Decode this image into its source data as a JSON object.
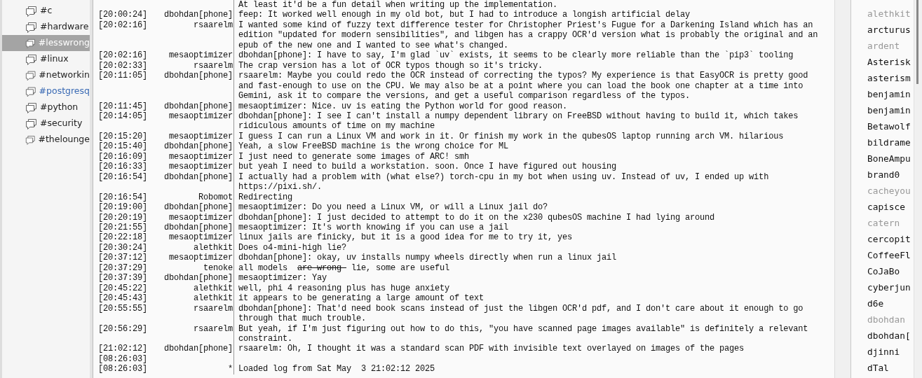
{
  "channels": [
    {
      "name": "#c",
      "selected": false,
      "activity": false
    },
    {
      "name": "#hardware",
      "selected": false,
      "activity": false
    },
    {
      "name": "#lesswrong",
      "selected": true,
      "activity": false
    },
    {
      "name": "#linux",
      "selected": false,
      "activity": false
    },
    {
      "name": "#networkin",
      "selected": false,
      "activity": false
    },
    {
      "name": "#postgresq",
      "selected": false,
      "activity": true
    },
    {
      "name": "#python",
      "selected": false,
      "activity": false
    },
    {
      "name": "#security",
      "selected": false,
      "activity": false
    },
    {
      "name": "#thelounge",
      "selected": false,
      "activity": false
    }
  ],
  "messages": [
    {
      "text": "At least it'd be a fun detail when writing up the implementation."
    },
    {
      "time": "[20:00:24]",
      "nick": "dbohdan[phone]",
      "text": "feep: It worked well enough in my old bot, but I had to introduce a longish artificial delay"
    },
    {
      "time": "[20:02:16]",
      "nick": "rsaarelm",
      "text": "I wanted some kind of fuzzy text difference tester for Christopher Priest's Fugue for a Darkening Island which has an edition \"updated for modern sensibilities\", and libgen has a crappy OCR'd version what is probably the original and an epub of the new one and I wanted to see what's changed."
    },
    {
      "time": "[20:02:16]",
      "nick": "mesaoptimizer",
      "text": "dbohdan[phone]: I have to say, I'm glad `uv` exists, it seems to be clearly more reliable than the `pip3` tooling"
    },
    {
      "time": "[20:02:33]",
      "nick": "rsaarelm",
      "text": "The crap version has a lot of OCR typos though so it's tricky."
    },
    {
      "time": "[20:11:05]",
      "nick": "dbohdan[phone]",
      "text": "rsaarelm: Maybe you could redo the OCR instead of correcting the typos? My experience is that EasyOCR is pretty good and fast-enough to use on the CPU. We may also be at a point where you can load the book one chapter at a time into Gemini, ask it to compare the versions, and get a useful comparison regardless of the typos."
    },
    {
      "time": "[20:11:45]",
      "nick": "dbohdan[phone]",
      "text": "mesaoptimizer: Nice. uv is eating the Python world for good reason."
    },
    {
      "time": "[20:14:05]",
      "nick": "mesaoptimizer",
      "text": "dbohdan[phone]: I see I can't install a numpy dependent library on FreeBSD without having to build it, which takes ridiculous amounts of time on my machine"
    },
    {
      "time": "[20:15:20]",
      "nick": "mesaoptimizer",
      "text": "I guess I can run a Linux VM and work in it. Or finish my work in the qubesOS laptop running arch VM. hilarious"
    },
    {
      "time": "[20:15:40]",
      "nick": "dbohdan[phone]",
      "text": "Yeah, a slow FreeBSD machine is the wrong choice for ML"
    },
    {
      "time": "[20:16:09]",
      "nick": "mesaoptimizer",
      "text": "I just need to generate some images of ARC! smh"
    },
    {
      "time": "[20:16:33]",
      "nick": "mesaoptimizer",
      "text": "but yeah I need to build a workstation. soon. Once I have figured out housing"
    },
    {
      "time": "[20:16:54]",
      "nick": "dbohdan[phone]",
      "text": "I actually had a problem with (what else?) torch-cpu in my bot when using uv. Instead of uv, I ended up with https://pixi.sh/."
    },
    {
      "time": "[20:16:54]",
      "nick": "Robomot",
      "text": "Redirecting"
    },
    {
      "time": "[20:19:00]",
      "nick": "dbohdan[phone]",
      "text": "mesaoptimizer: Do you need a Linux VM, or will a Linux jail do?"
    },
    {
      "time": "[20:20:19]",
      "nick": "mesaoptimizer",
      "text": "dbohdan[phone]: I just decided to attempt to do it on the x230 qubesOS machine I had lying around"
    },
    {
      "time": "[20:21:55]",
      "nick": "dbohdan[phone]",
      "text": "mesaoptimizer: It's worth knowing if you can use a jail"
    },
    {
      "time": "[20:22:18]",
      "nick": "mesaoptimizer",
      "text": "linux jails are finicky, but it is a good idea for me to try it, yes"
    },
    {
      "time": "[20:30:24]",
      "nick": "alethkit",
      "text": "Does o4-mini-high lie?"
    },
    {
      "time": "[20:37:12]",
      "nick": "mesaoptimizer",
      "text": "dbohdan[phone]: okay, uv installs numpy wheels directly when run a linux jail"
    },
    {
      "time": "[20:37:29]",
      "nick": "tenoke",
      "parts": [
        {
          "text": "all models  ",
          "struck": false
        },
        {
          "text": "are wrong ",
          "struck": true
        },
        {
          "text": " lie, some are useful",
          "struck": false
        }
      ]
    },
    {
      "time": "[20:37:39]",
      "nick": "dbohdan[phone]",
      "text": "mesaoptimizer: Yay"
    },
    {
      "time": "[20:45:22]",
      "nick": "alethkit",
      "text": "well, phi 4 reasoning plus has huge anxiety"
    },
    {
      "time": "[20:45:43]",
      "nick": "alethkit",
      "text": "it appears to be generating a large amount of text"
    },
    {
      "time": "[20:55:55]",
      "nick": "rsaarelm",
      "text": "dbohdan[phone]: That'd need book scans instead of just the libgen OCR'd pdf, and I don't care about it enough to go through that much trouble."
    },
    {
      "time": "[20:56:29]",
      "nick": "rsaarelm",
      "text": "But yeah, if I'm just figuring out how to do this, \"you have scanned page images available\" is definitely a relevant constraint."
    },
    {
      "time": "[21:02:12]",
      "nick": "dbohdan[phone]",
      "text": "rsaarelm: Oh, I thought it was a standard scan PDF with invisible text overlayed on images of the pages"
    },
    {
      "time": "[08:26:03]"
    },
    {
      "time": "[08:26:03]",
      "nick": "*",
      "text": "Loaded log from Sat May  3 21:02:12 2025"
    }
  ],
  "nicks": [
    {
      "name": "alethkit",
      "away": true
    },
    {
      "name": "arcturus",
      "away": false
    },
    {
      "name": "ardent",
      "away": true
    },
    {
      "name": "Asterisk",
      "away": false
    },
    {
      "name": "asterism",
      "away": false
    },
    {
      "name": "benjamin",
      "away": false
    },
    {
      "name": "benjamin",
      "away": false
    },
    {
      "name": "Betawolf",
      "away": false
    },
    {
      "name": "bildrame",
      "away": false
    },
    {
      "name": "BoneAmpu",
      "away": false
    },
    {
      "name": "brand0",
      "away": false
    },
    {
      "name": "cacheyou",
      "away": true
    },
    {
      "name": "capisce",
      "away": false
    },
    {
      "name": "catern",
      "away": true
    },
    {
      "name": "cercopit",
      "away": false
    },
    {
      "name": "CoffeeFl",
      "away": false
    },
    {
      "name": "CoJaBo",
      "away": false
    },
    {
      "name": "cyberjun",
      "away": false
    },
    {
      "name": "d6e",
      "away": false
    },
    {
      "name": "dbohdan",
      "away": true
    },
    {
      "name": "dbohdan[",
      "away": false
    },
    {
      "name": "djinni",
      "away": false
    },
    {
      "name": "dTal",
      "away": false
    }
  ]
}
